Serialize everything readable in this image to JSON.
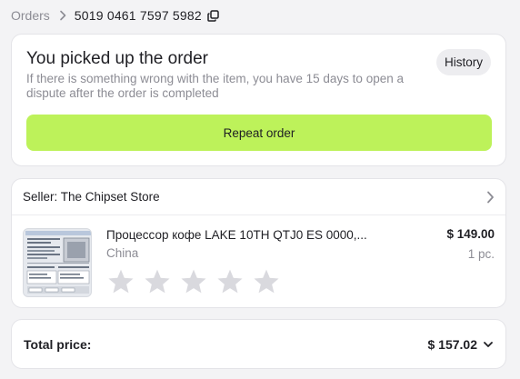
{
  "breadcrumb": {
    "parent": "Orders",
    "current": "5019 0461 7597 5982"
  },
  "status": {
    "title": "You picked up the order",
    "description": "If there is something wrong with the item, you have 15 days to open a dispute after the order is completed",
    "history_label": "History",
    "repeat_label": "Repeat order"
  },
  "seller": {
    "label": "Seller: The Chipset Store"
  },
  "product": {
    "title": "Процессор кофе LAKE 10TH QTJ0 ES 0000,...",
    "origin": "China",
    "price": "$ 149.00",
    "quantity": "1 pc.",
    "rating": {
      "value": 0,
      "max": 5
    }
  },
  "total": {
    "label": "Total price:",
    "value": "$ 157.02"
  },
  "colors": {
    "accent": "#bdf25a",
    "muted_text": "#8c8c94",
    "page_bg": "#f3f3f5"
  },
  "icons": {
    "breadcrumb_separator": "chevron-right-icon",
    "copy": "copy-icon",
    "seller_arrow": "chevron-right-icon",
    "rating": "star-icon",
    "total_expand": "chevron-down-icon"
  }
}
